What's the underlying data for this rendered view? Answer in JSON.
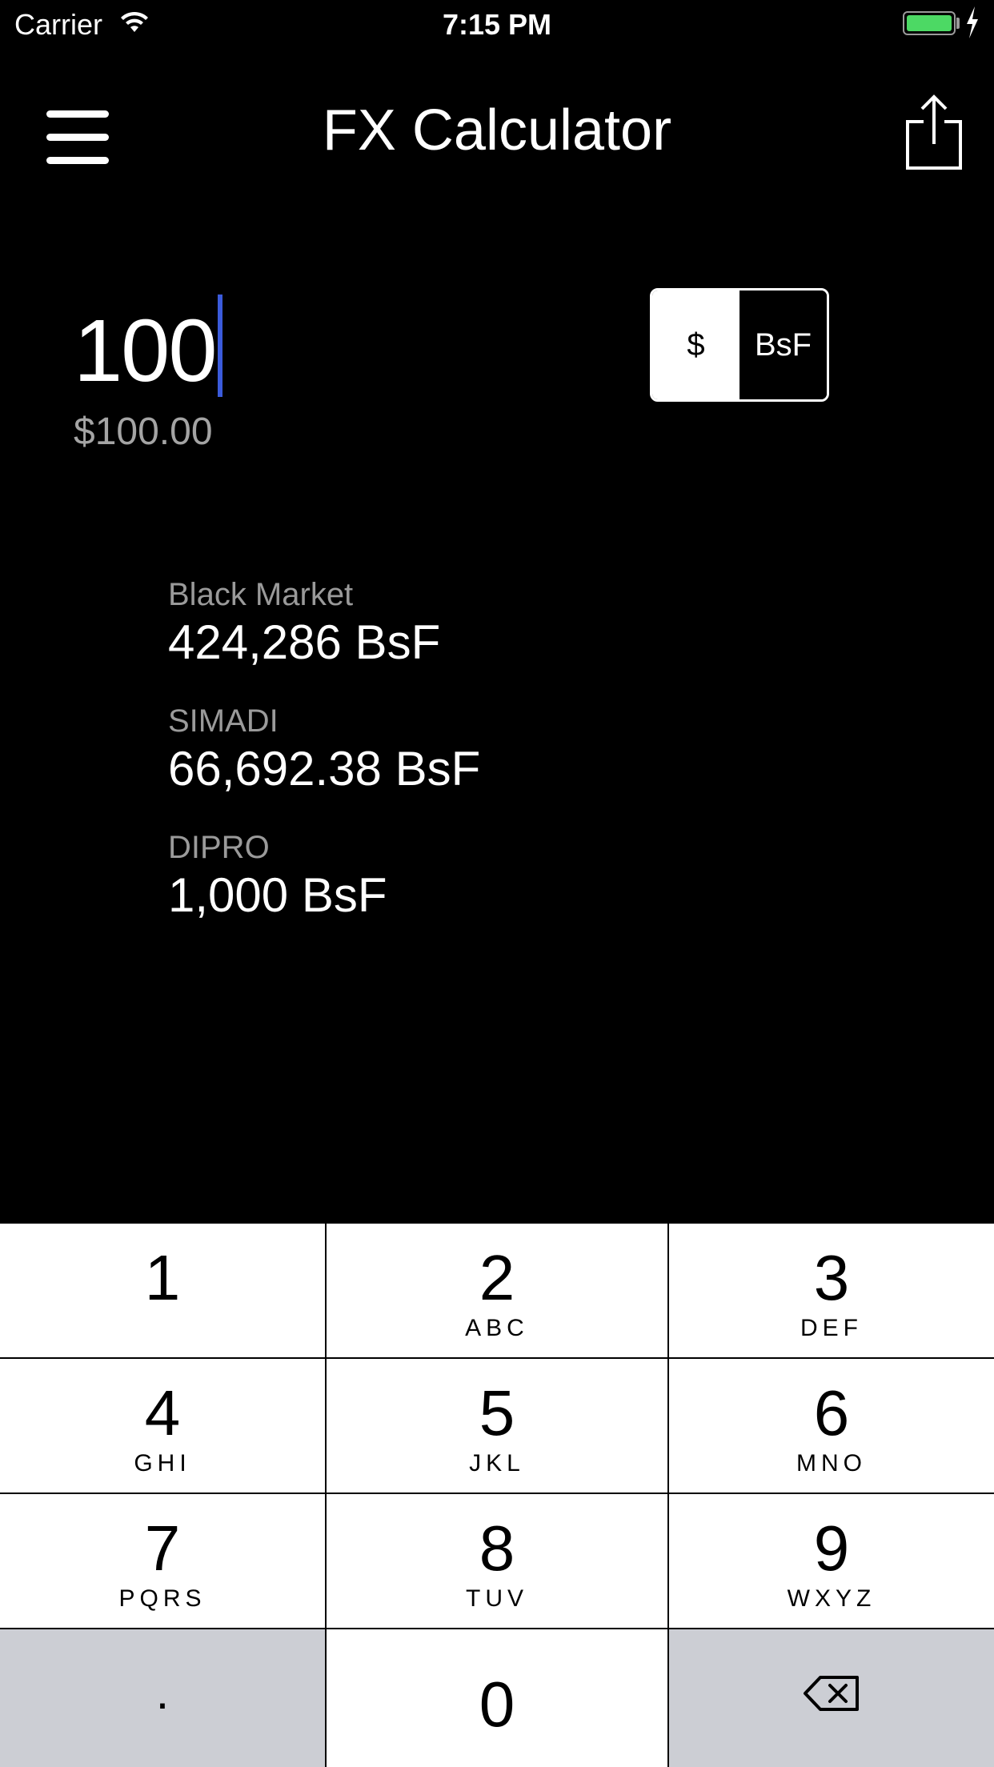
{
  "status_bar": {
    "carrier": "Carrier",
    "time": "7:15 PM",
    "battery_color": "#4cd964"
  },
  "nav": {
    "title": "FX Calculator",
    "menu_icon": "hamburger-icon",
    "share_icon": "share-icon"
  },
  "amount": {
    "input_value": "100",
    "formatted": "$100.00",
    "caret_color": "#3b5bdb"
  },
  "currency_toggle": {
    "options": [
      "$",
      "BsF"
    ],
    "selected": "$"
  },
  "rates": [
    {
      "label": "Black Market",
      "value": "424,286 BsF"
    },
    {
      "label": "SIMADI",
      "value": "66,692.38 BsF"
    },
    {
      "label": "DIPRO",
      "value": "1,000 BsF"
    }
  ],
  "keypad": {
    "keys": [
      {
        "digit": "1",
        "letters": ""
      },
      {
        "digit": "2",
        "letters": "ABC"
      },
      {
        "digit": "3",
        "letters": "DEF"
      },
      {
        "digit": "4",
        "letters": "GHI"
      },
      {
        "digit": "5",
        "letters": "JKL"
      },
      {
        "digit": "6",
        "letters": "MNO"
      },
      {
        "digit": "7",
        "letters": "PQRS"
      },
      {
        "digit": "8",
        "letters": "TUV"
      },
      {
        "digit": "9",
        "letters": "WXYZ"
      }
    ],
    "decimal": ".",
    "zero": "0",
    "delete_icon": "backspace-icon"
  }
}
